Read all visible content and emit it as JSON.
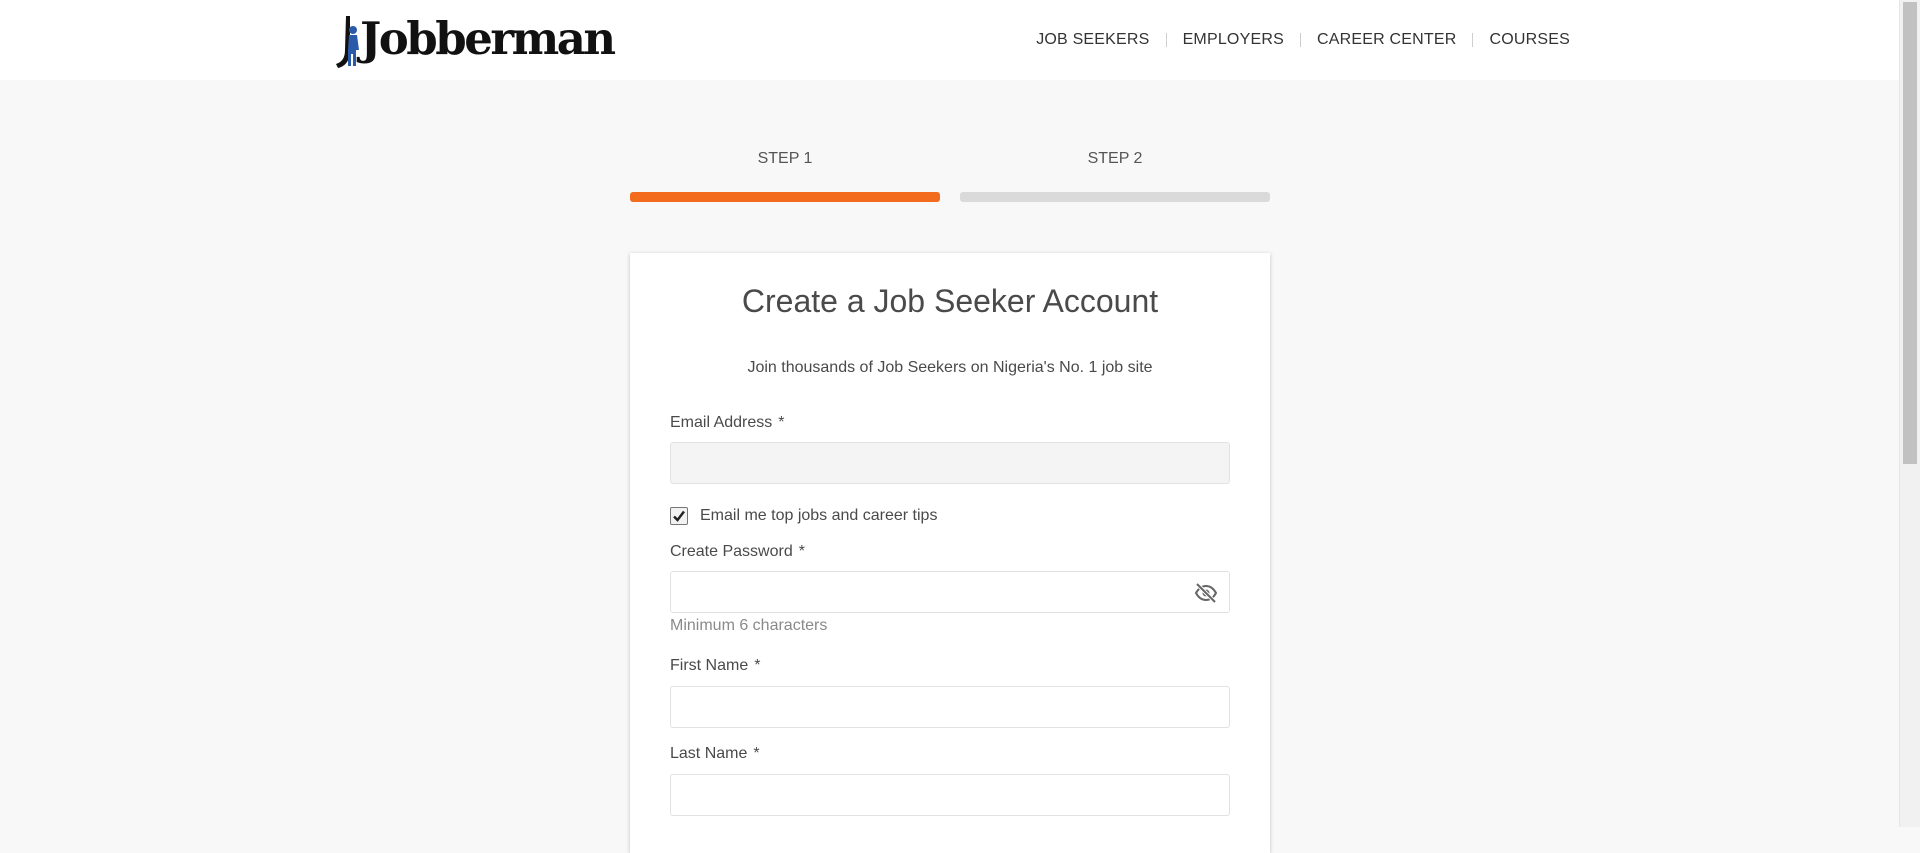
{
  "header": {
    "logo_text": "Jobberman",
    "nav": [
      {
        "label": "JOB SEEKERS"
      },
      {
        "label": "EMPLOYERS"
      },
      {
        "label": "CAREER CENTER"
      },
      {
        "label": "COURSES"
      }
    ]
  },
  "steps": [
    {
      "label": "STEP 1",
      "active": true,
      "color": "#f36b1c"
    },
    {
      "label": "STEP 2",
      "active": false,
      "color": "#dadada"
    }
  ],
  "form": {
    "title": "Create a Job Seeker Account",
    "subtitle": "Join thousands of Job Seekers on Nigeria's No. 1 job site",
    "required_marker": "*",
    "email_label": "Email Address",
    "email_value": "",
    "newsletter_label": "Email me top jobs and career tips",
    "newsletter_checked": true,
    "password_label": "Create Password",
    "password_value": "",
    "password_hint": "Minimum 6 characters",
    "password_toggle_icon": "eye-off-icon",
    "first_name_label": "First Name",
    "first_name_value": "",
    "last_name_label": "Last Name",
    "last_name_value": ""
  },
  "colors": {
    "accent": "#f36b1c",
    "inactive_step": "#dadada",
    "page_bg": "#f8f8f8",
    "logo_blue": "#2a5aa8"
  }
}
